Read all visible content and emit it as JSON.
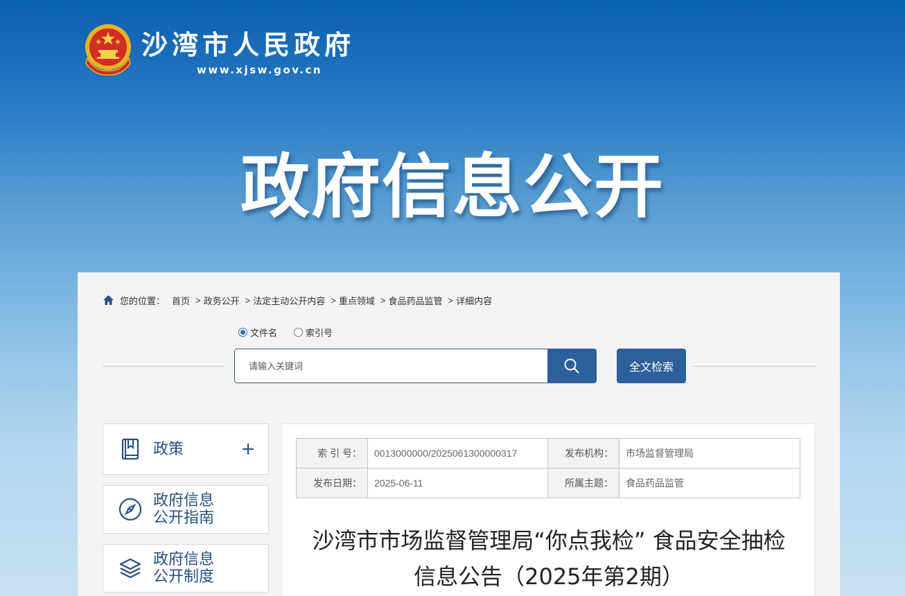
{
  "header": {
    "site_name": "沙湾市人民政府",
    "site_url": "www.xjsw.gov.cn",
    "hero_title": "政府信息公开",
    "emblem_icon": "national-emblem-icon"
  },
  "breadcrumb": {
    "label": "您的位置：",
    "items": [
      "首页",
      "政务公开",
      "法定主动公开内容",
      "重点领域",
      "食品药品监管",
      "详细内容"
    ],
    "separator": ">"
  },
  "search": {
    "options": [
      {
        "label": "文件名",
        "checked": true
      },
      {
        "label": "索引号",
        "checked": false
      }
    ],
    "placeholder": "请输入关键词",
    "search_icon": "search-icon",
    "fulltext_label": "全文检索"
  },
  "sidebar": {
    "items": [
      {
        "label": "政策",
        "icon": "book-icon",
        "expand_icon": "plus-icon"
      },
      {
        "label": "政府信息\n公开指南",
        "icon": "compass-icon"
      },
      {
        "label": "政府信息\n公开制度",
        "icon": "layers-icon"
      }
    ]
  },
  "meta": {
    "index_label": "索 引 号：",
    "index_value": "0013000000/2025061300000317",
    "org_label": "发布机构：",
    "org_value": "市场监督管理局",
    "date_label": "发布日期：",
    "date_value": "2025-06-11",
    "topic_label": "所属主题：",
    "topic_value": "食品药品监管"
  },
  "document": {
    "title": "沙湾市市场监督管理局“你点我检” 食品安全抽检信息公告（2025年第2期）"
  },
  "colors": {
    "accent": "#2d5f9b",
    "sidebar_text": "#244f86",
    "header_top": "#0b5fb0"
  }
}
